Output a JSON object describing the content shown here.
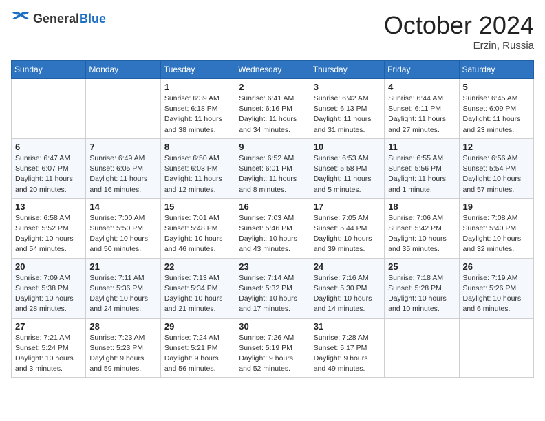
{
  "header": {
    "logo_general": "General",
    "logo_blue": "Blue",
    "month_title": "October 2024",
    "location": "Erzin, Russia"
  },
  "days_of_week": [
    "Sunday",
    "Monday",
    "Tuesday",
    "Wednesday",
    "Thursday",
    "Friday",
    "Saturday"
  ],
  "weeks": [
    [
      {
        "day": "",
        "info": ""
      },
      {
        "day": "",
        "info": ""
      },
      {
        "day": "1",
        "info": "Sunrise: 6:39 AM\nSunset: 6:18 PM\nDaylight: 11 hours and 38 minutes."
      },
      {
        "day": "2",
        "info": "Sunrise: 6:41 AM\nSunset: 6:16 PM\nDaylight: 11 hours and 34 minutes."
      },
      {
        "day": "3",
        "info": "Sunrise: 6:42 AM\nSunset: 6:13 PM\nDaylight: 11 hours and 31 minutes."
      },
      {
        "day": "4",
        "info": "Sunrise: 6:44 AM\nSunset: 6:11 PM\nDaylight: 11 hours and 27 minutes."
      },
      {
        "day": "5",
        "info": "Sunrise: 6:45 AM\nSunset: 6:09 PM\nDaylight: 11 hours and 23 minutes."
      }
    ],
    [
      {
        "day": "6",
        "info": "Sunrise: 6:47 AM\nSunset: 6:07 PM\nDaylight: 11 hours and 20 minutes."
      },
      {
        "day": "7",
        "info": "Sunrise: 6:49 AM\nSunset: 6:05 PM\nDaylight: 11 hours and 16 minutes."
      },
      {
        "day": "8",
        "info": "Sunrise: 6:50 AM\nSunset: 6:03 PM\nDaylight: 11 hours and 12 minutes."
      },
      {
        "day": "9",
        "info": "Sunrise: 6:52 AM\nSunset: 6:01 PM\nDaylight: 11 hours and 8 minutes."
      },
      {
        "day": "10",
        "info": "Sunrise: 6:53 AM\nSunset: 5:58 PM\nDaylight: 11 hours and 5 minutes."
      },
      {
        "day": "11",
        "info": "Sunrise: 6:55 AM\nSunset: 5:56 PM\nDaylight: 11 hours and 1 minute."
      },
      {
        "day": "12",
        "info": "Sunrise: 6:56 AM\nSunset: 5:54 PM\nDaylight: 10 hours and 57 minutes."
      }
    ],
    [
      {
        "day": "13",
        "info": "Sunrise: 6:58 AM\nSunset: 5:52 PM\nDaylight: 10 hours and 54 minutes."
      },
      {
        "day": "14",
        "info": "Sunrise: 7:00 AM\nSunset: 5:50 PM\nDaylight: 10 hours and 50 minutes."
      },
      {
        "day": "15",
        "info": "Sunrise: 7:01 AM\nSunset: 5:48 PM\nDaylight: 10 hours and 46 minutes."
      },
      {
        "day": "16",
        "info": "Sunrise: 7:03 AM\nSunset: 5:46 PM\nDaylight: 10 hours and 43 minutes."
      },
      {
        "day": "17",
        "info": "Sunrise: 7:05 AM\nSunset: 5:44 PM\nDaylight: 10 hours and 39 minutes."
      },
      {
        "day": "18",
        "info": "Sunrise: 7:06 AM\nSunset: 5:42 PM\nDaylight: 10 hours and 35 minutes."
      },
      {
        "day": "19",
        "info": "Sunrise: 7:08 AM\nSunset: 5:40 PM\nDaylight: 10 hours and 32 minutes."
      }
    ],
    [
      {
        "day": "20",
        "info": "Sunrise: 7:09 AM\nSunset: 5:38 PM\nDaylight: 10 hours and 28 minutes."
      },
      {
        "day": "21",
        "info": "Sunrise: 7:11 AM\nSunset: 5:36 PM\nDaylight: 10 hours and 24 minutes."
      },
      {
        "day": "22",
        "info": "Sunrise: 7:13 AM\nSunset: 5:34 PM\nDaylight: 10 hours and 21 minutes."
      },
      {
        "day": "23",
        "info": "Sunrise: 7:14 AM\nSunset: 5:32 PM\nDaylight: 10 hours and 17 minutes."
      },
      {
        "day": "24",
        "info": "Sunrise: 7:16 AM\nSunset: 5:30 PM\nDaylight: 10 hours and 14 minutes."
      },
      {
        "day": "25",
        "info": "Sunrise: 7:18 AM\nSunset: 5:28 PM\nDaylight: 10 hours and 10 minutes."
      },
      {
        "day": "26",
        "info": "Sunrise: 7:19 AM\nSunset: 5:26 PM\nDaylight: 10 hours and 6 minutes."
      }
    ],
    [
      {
        "day": "27",
        "info": "Sunrise: 7:21 AM\nSunset: 5:24 PM\nDaylight: 10 hours and 3 minutes."
      },
      {
        "day": "28",
        "info": "Sunrise: 7:23 AM\nSunset: 5:23 PM\nDaylight: 9 hours and 59 minutes."
      },
      {
        "day": "29",
        "info": "Sunrise: 7:24 AM\nSunset: 5:21 PM\nDaylight: 9 hours and 56 minutes."
      },
      {
        "day": "30",
        "info": "Sunrise: 7:26 AM\nSunset: 5:19 PM\nDaylight: 9 hours and 52 minutes."
      },
      {
        "day": "31",
        "info": "Sunrise: 7:28 AM\nSunset: 5:17 PM\nDaylight: 9 hours and 49 minutes."
      },
      {
        "day": "",
        "info": ""
      },
      {
        "day": "",
        "info": ""
      }
    ]
  ]
}
